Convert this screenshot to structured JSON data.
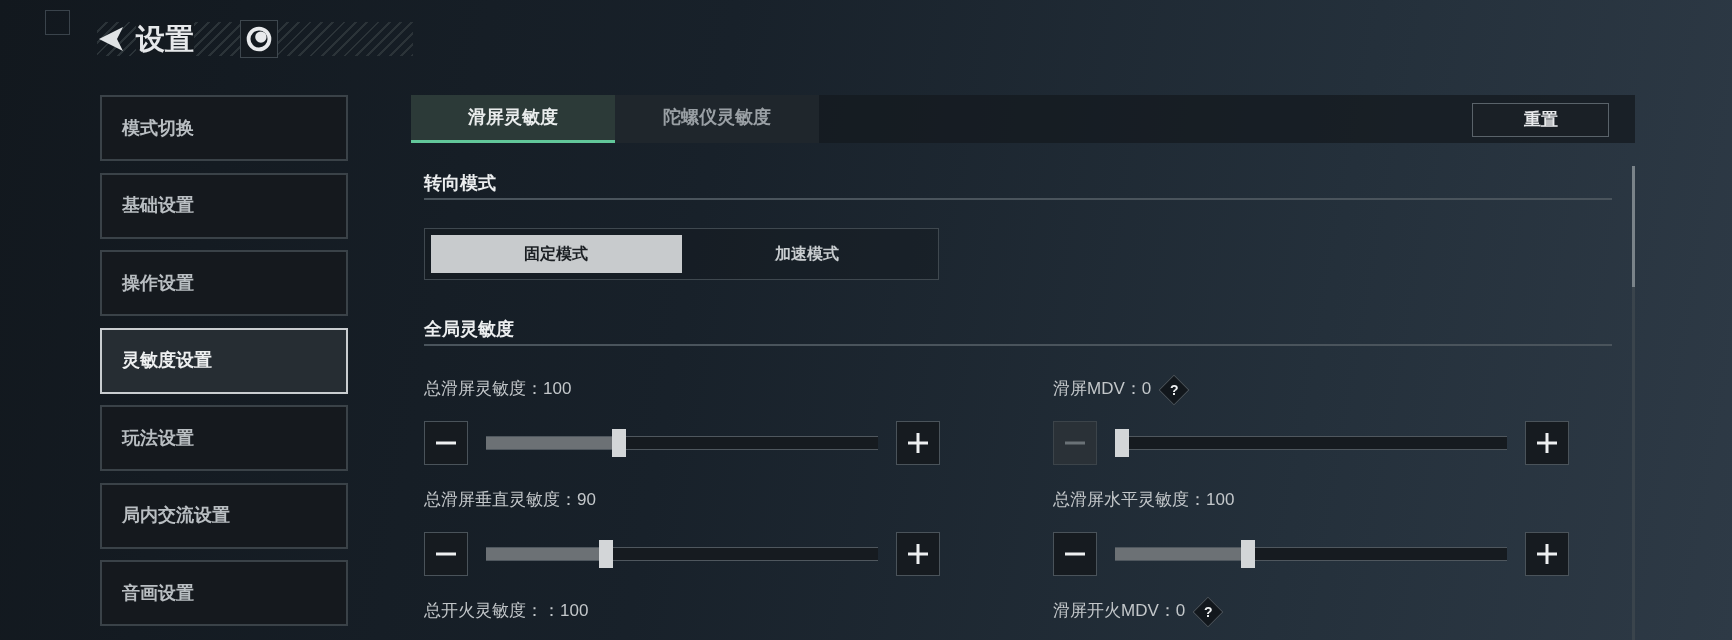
{
  "header": {
    "title": "设置"
  },
  "sidebar": {
    "items": [
      {
        "label": "模式切换",
        "selected": false
      },
      {
        "label": "基础设置",
        "selected": false
      },
      {
        "label": "操作设置",
        "selected": false
      },
      {
        "label": "灵敏度设置",
        "selected": true
      },
      {
        "label": "玩法设置",
        "selected": false
      },
      {
        "label": "局内交流设置",
        "selected": false
      },
      {
        "label": "音画设置",
        "selected": false
      }
    ]
  },
  "tabs": [
    {
      "label": "滑屏灵敏度",
      "selected": true
    },
    {
      "label": "陀螺仪灵敏度",
      "selected": false
    }
  ],
  "reset_button": "重置",
  "sections": [
    {
      "title": "转向模式",
      "kind": "segmented",
      "options": [
        {
          "label": "固定模式",
          "selected": true
        },
        {
          "label": "加速模式",
          "selected": false
        }
      ]
    },
    {
      "title": "全局灵敏度",
      "kind": "settings",
      "settings": [
        {
          "kind": "slider",
          "label": "总滑屏灵敏度：100",
          "level": 0.34,
          "minus_disabled": false
        },
        {
          "kind": "slider",
          "label": "滑屏MDV：0",
          "help": "?",
          "level": 0.0,
          "minus_disabled": true
        },
        {
          "kind": "slider",
          "label": "总滑屏垂直灵敏度：90",
          "level": 0.305,
          "minus_disabled": false
        },
        {
          "kind": "slider",
          "label": "总滑屏水平灵敏度：100",
          "level": 0.34,
          "minus_disabled": false
        },
        {
          "kind": "caption",
          "label": "总开火灵敏度：：100"
        },
        {
          "kind": "caption",
          "label": "滑屏开火MDV：0",
          "help": "?"
        }
      ]
    }
  ]
}
